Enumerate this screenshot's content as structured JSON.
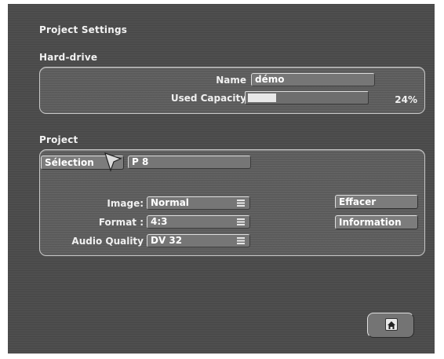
{
  "header": {
    "title": "Project Settings"
  },
  "hard_drive": {
    "section_label": "Hard-drive",
    "name_label": "Name",
    "name_value": "démo",
    "capacity_label": "Used Capacity",
    "capacity_percent_text": "24%",
    "capacity_fraction": 0.24
  },
  "project": {
    "section_label": "Project",
    "selection_label": "Sélection",
    "selection_value": "P 8",
    "image_label": "Image:",
    "image_value": "Normal",
    "format_label": "Format :",
    "format_value": "4:3",
    "audio_label": "Audio Quality",
    "audio_value": "DV 32",
    "delete_button": "Effacer",
    "info_button": "Information"
  },
  "icons": {
    "home": "home-icon",
    "menu": "menu-icon",
    "cursor": "arrow-cursor-icon"
  }
}
